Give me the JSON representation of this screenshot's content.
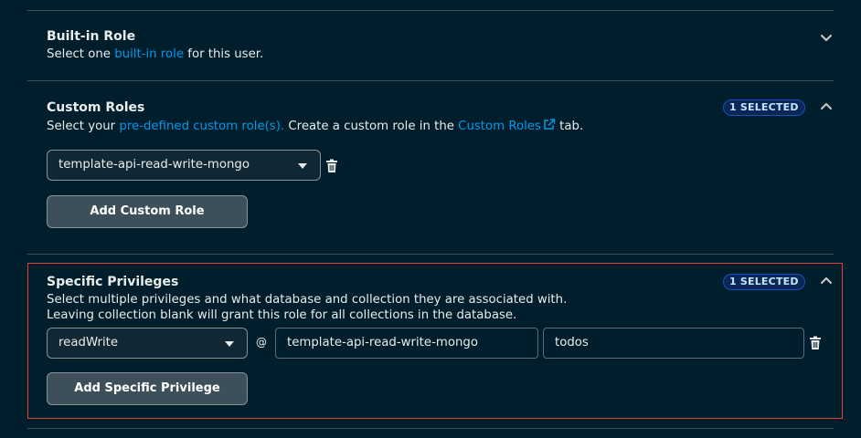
{
  "builtin_role": {
    "title": "Built-in Role",
    "desc_pre": "Select one ",
    "desc_link": "built-in role",
    "desc_post": " for this user."
  },
  "custom_roles": {
    "title": "Custom Roles",
    "badge": "1 SELECTED",
    "desc_pre": "Select your ",
    "desc_link1": "pre-defined custom role(s).",
    "desc_mid": " Create a custom role in the ",
    "desc_link2": "Custom Roles",
    "desc_post": " tab.",
    "selected_role": "template-api-read-write-mongo",
    "add_button": "Add Custom Role"
  },
  "specific_privileges": {
    "title": "Specific Privileges",
    "badge": "1 SELECTED",
    "desc_line1": "Select multiple privileges and what database and collection they are associated with.",
    "desc_line2": "Leaving collection blank will grant this role for all collections in the database.",
    "privilege": "readWrite",
    "at_symbol": "@",
    "database": "template-api-read-write-mongo",
    "collection": "todos",
    "add_button": "Add Specific Privilege"
  },
  "colors": {
    "background": "#001e2b",
    "link": "#0498ec",
    "highlight_border": "#e0423d",
    "badge_bg": "#0c2657"
  }
}
